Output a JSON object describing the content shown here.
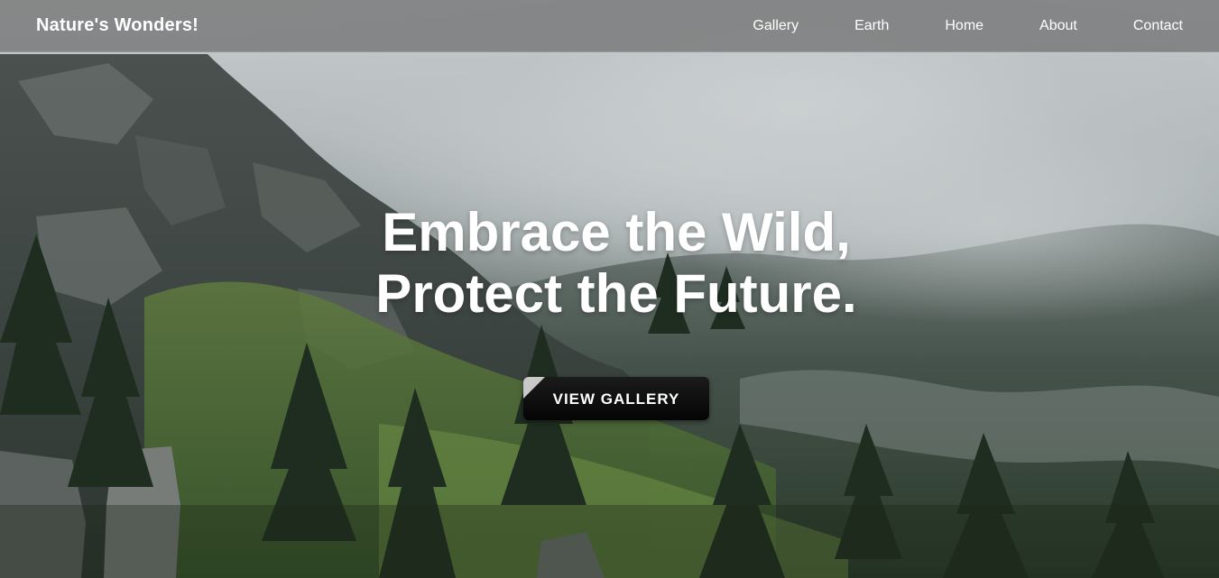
{
  "nav": {
    "brand": "Nature's Wonders!",
    "links": [
      "Gallery",
      "Earth",
      "Home",
      "About",
      "Contact"
    ]
  },
  "hero": {
    "headline_line1": "Embrace the Wild,",
    "headline_line2": "Protect the Future.",
    "cta_label": "VIEW GALLERY"
  },
  "colors": {
    "nav_background": "#6e6e6e",
    "text": "#ffffff",
    "button": "#0a0a0a",
    "button_fold": "#c9c9c9"
  }
}
